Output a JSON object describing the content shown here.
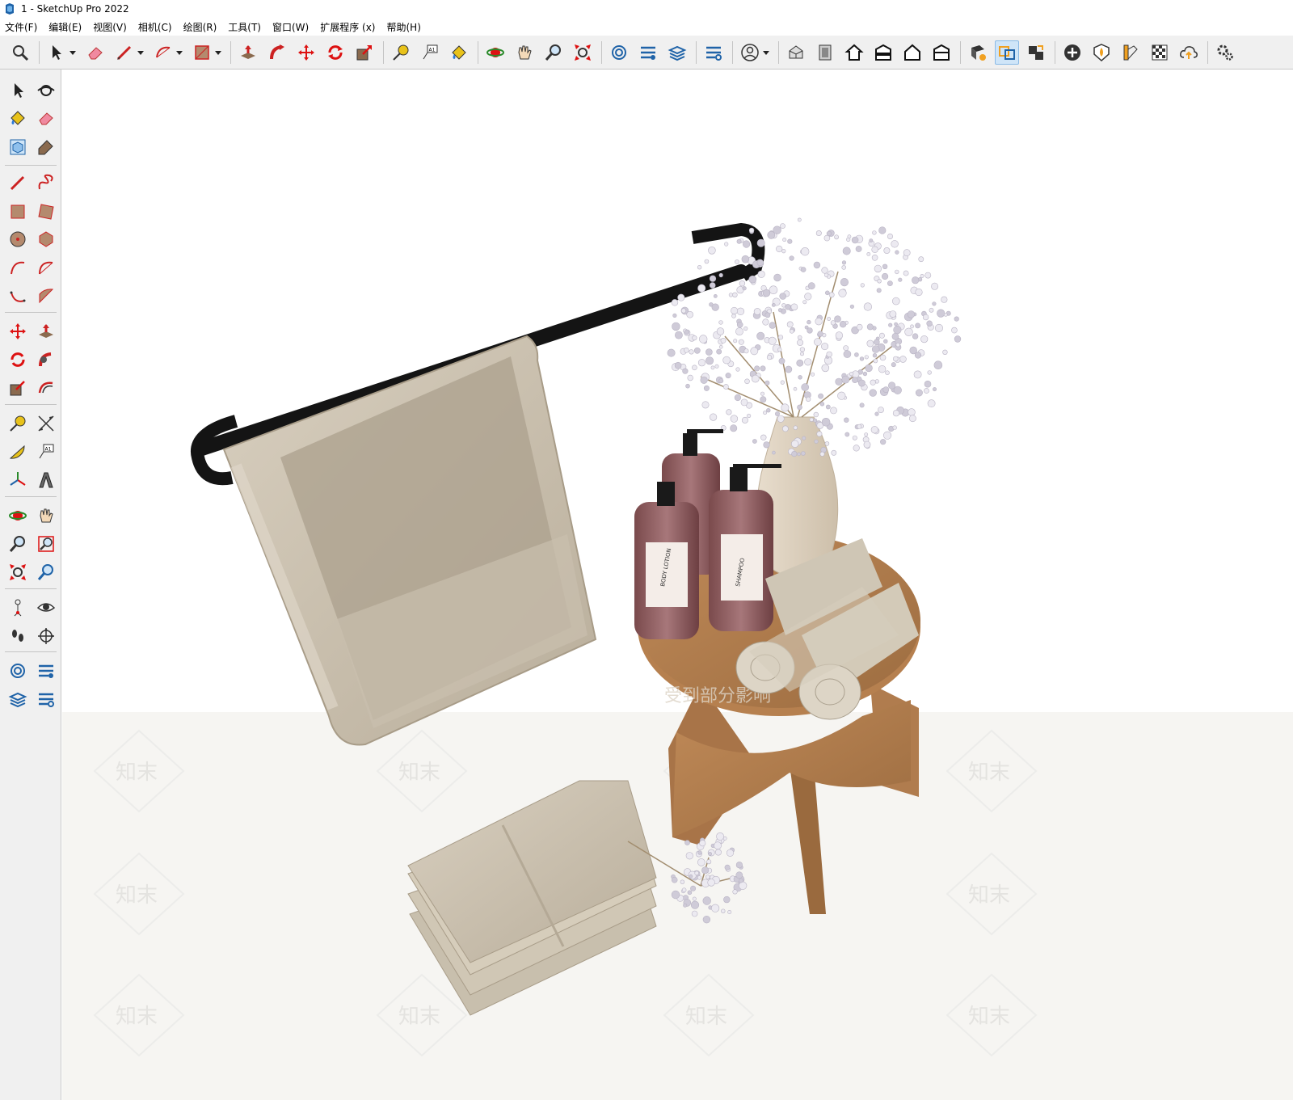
{
  "window": {
    "title": "1 - SketchUp Pro 2022"
  },
  "menu": [
    "文件(F)",
    "编辑(E)",
    "视图(V)",
    "相机(C)",
    "绘图(R)",
    "工具(T)",
    "窗口(W)",
    "扩展程序 (x)",
    "帮助(H)"
  ],
  "toolbar": {
    "icons": [
      "zoom-tool-icon",
      "select-arrow-icon",
      "eraser-icon",
      "pencil-line-icon",
      "arc-icon",
      "rectangle-icon",
      "push-pull-icon",
      "follow-me-icon",
      "move-icon",
      "rotate-icon",
      "scale-icon",
      "tape-measure-icon",
      "text-label-icon",
      "paint-bucket-icon",
      "orbit-icon",
      "pan-icon",
      "zoom-icon",
      "zoom-extents-icon",
      "warehouse-icon",
      "extension-warehouse-icon",
      "layout-icon",
      "extension-manager-icon",
      "account-icon",
      "iso-view-icon",
      "top-view-icon",
      "front-view-icon",
      "right-view-icon",
      "back-view-icon",
      "left-view-icon",
      "solid-inspector-icon",
      "outer-shell-icon",
      "intersect-icon",
      "add-location-icon",
      "sandbox-icon",
      "styles-icon",
      "shadows-icon",
      "cloud-upload-icon",
      "settings-icon"
    ]
  },
  "left_toolbar": {
    "icons": [
      "select-icon",
      "orbit-icon",
      "paint-bucket-icon",
      "eraser-icon",
      "make-component-icon",
      "tag-icon",
      "line-icon",
      "freehand-icon",
      "rectangle-icon",
      "rotated-rectangle-icon",
      "circle-icon",
      "polygon-icon",
      "arc-icon",
      "2point-arc-icon",
      "3point-arc-icon",
      "pie-icon",
      "move-icon",
      "push-pull-icon",
      "rotate-icon",
      "follow-me-icon",
      "scale-icon",
      "offset-icon",
      "tape-measure-icon",
      "dimension-icon",
      "protractor-icon",
      "text-icon",
      "axes-icon",
      "3d-text-icon",
      "orbit-icon",
      "pan-icon",
      "zoom-icon",
      "zoom-window-icon",
      "zoom-extents-icon",
      "previous-view-icon",
      "position-camera-icon",
      "look-around-icon",
      "walk-icon",
      "section-plane-icon",
      "warehouse-icon",
      "extension-warehouse-icon",
      "layout-icon",
      "extension-manager-icon"
    ]
  },
  "scene": {
    "watermark_text": "知末",
    "watermark_caption": "受到部分影响",
    "bottle_labels": [
      "BODY LOTION",
      "SHAMPOO"
    ]
  }
}
